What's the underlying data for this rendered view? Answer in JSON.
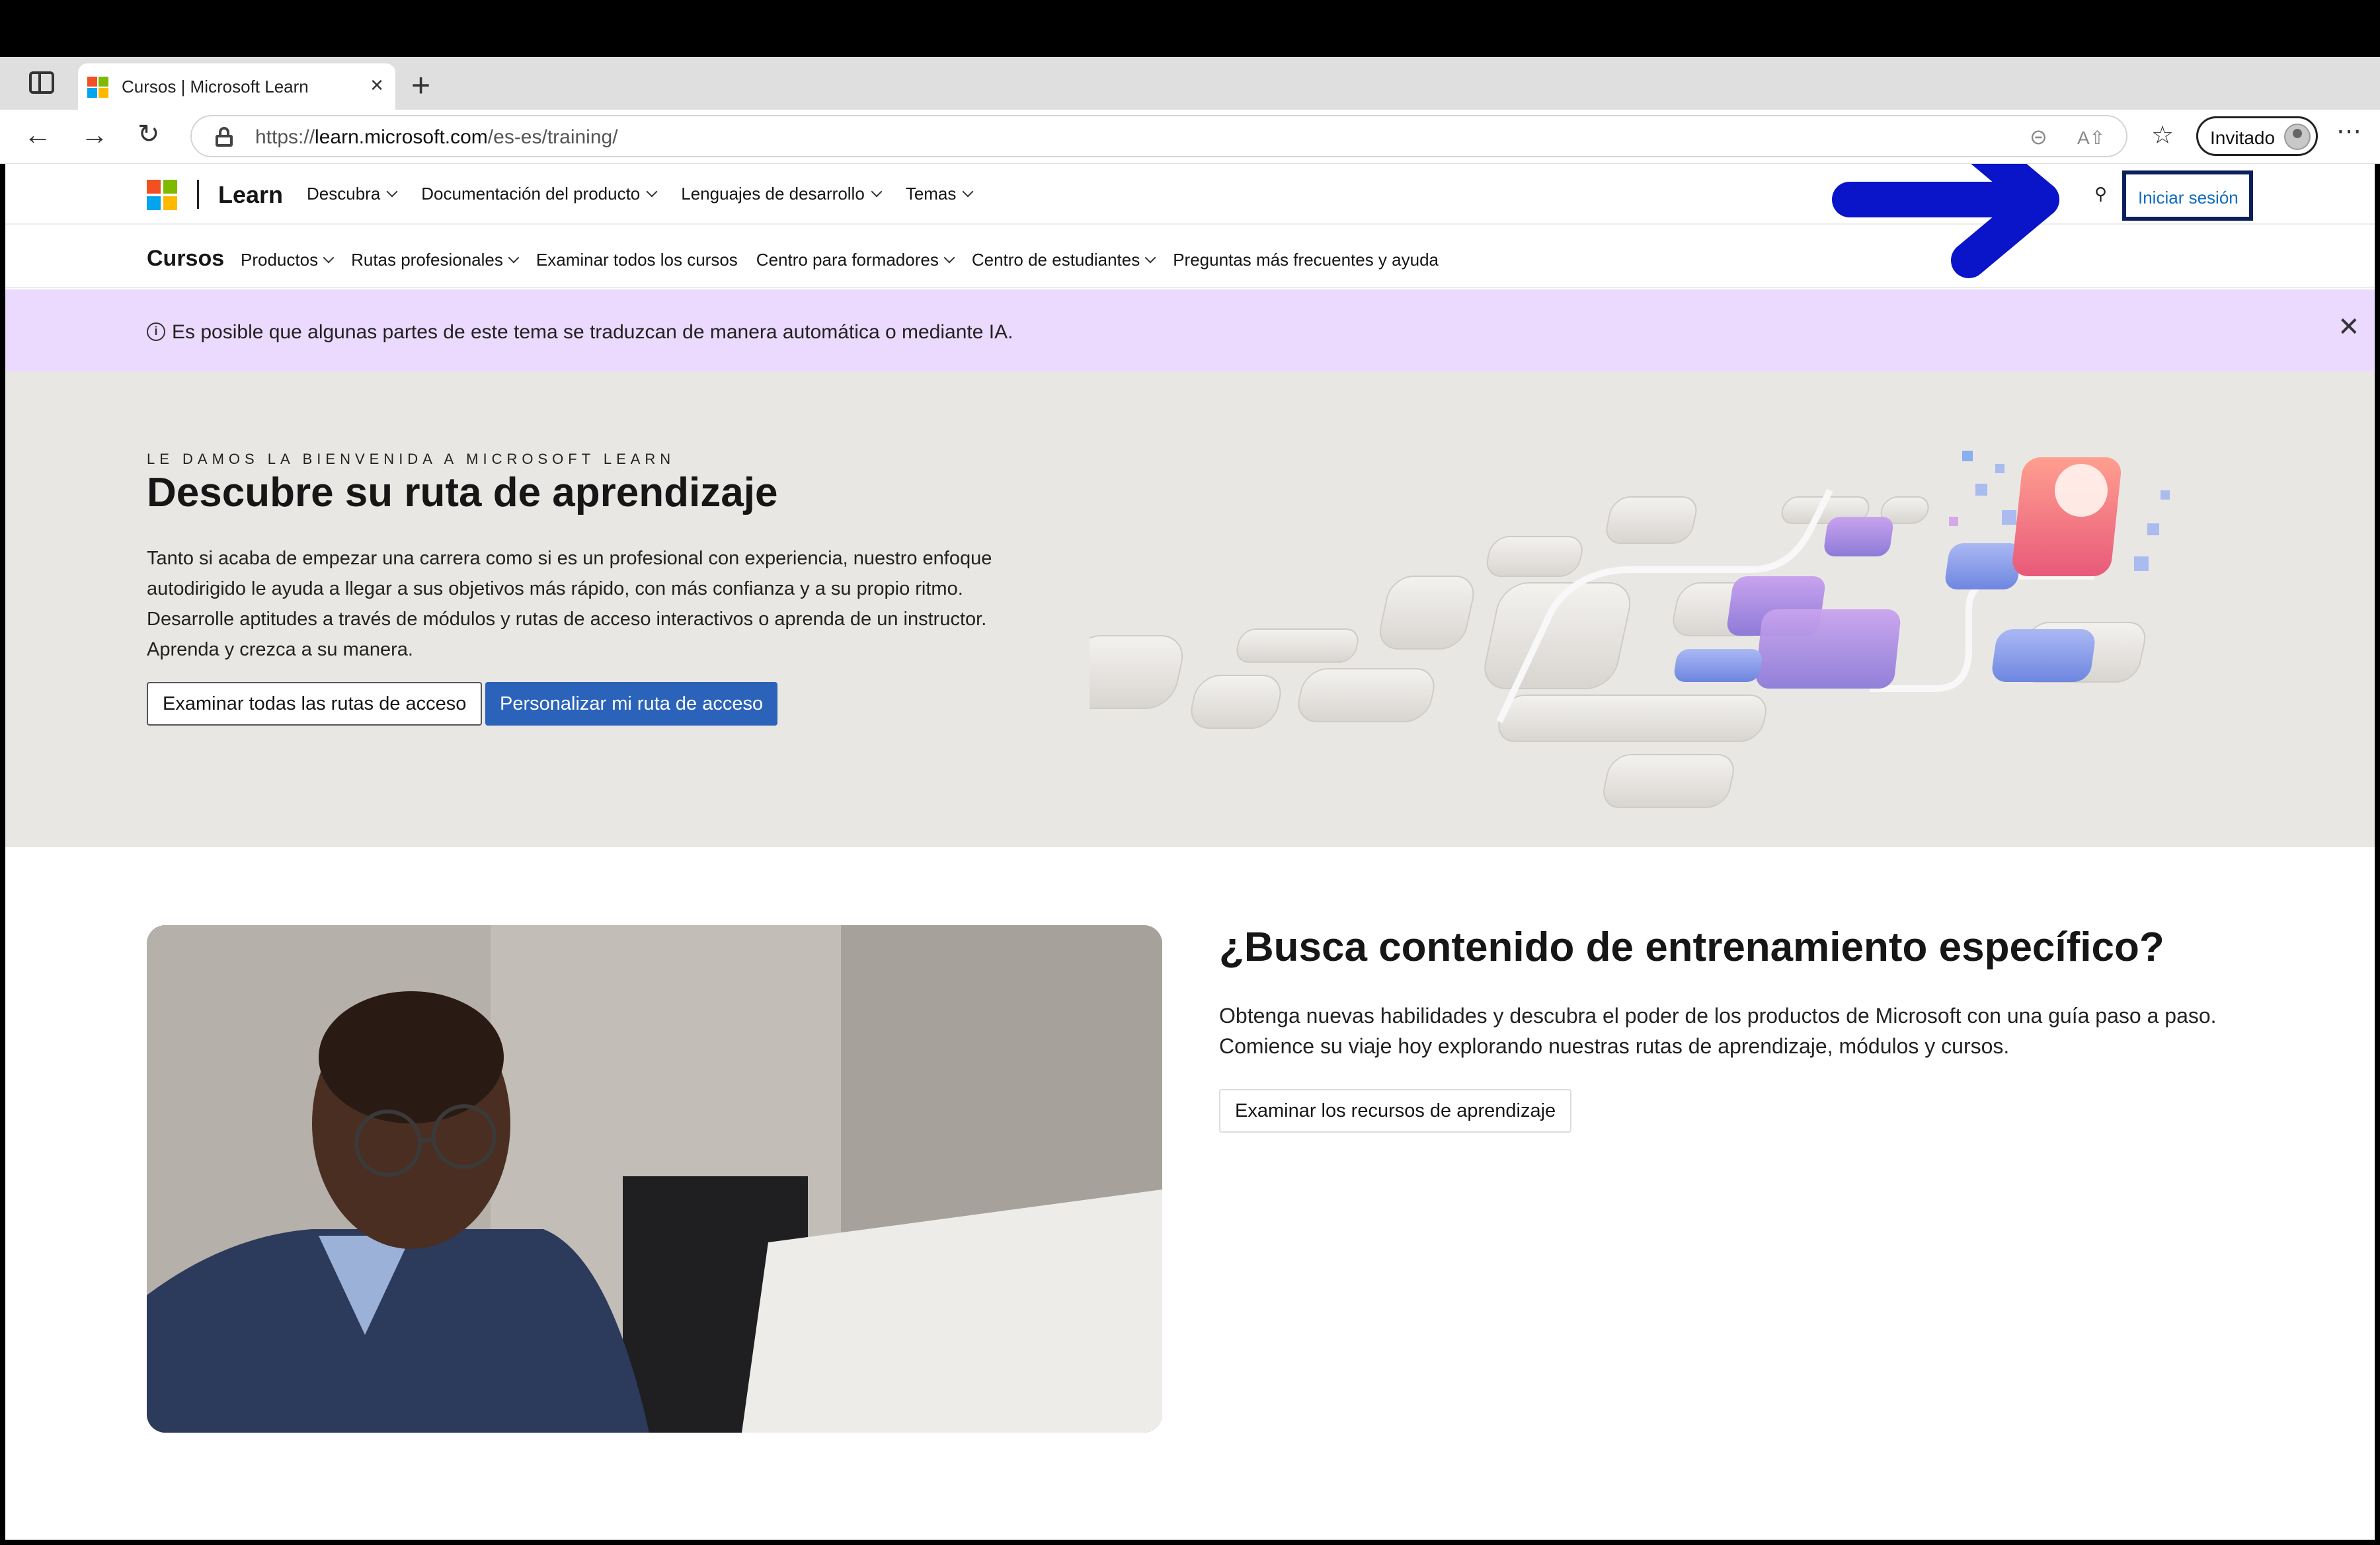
{
  "browser": {
    "tab_title": "Cursos | Microsoft Learn",
    "tab_close": "×",
    "new_tab": "+",
    "url_prefix": "https://",
    "url_domain": "learn.microsoft.com",
    "url_path": "/es-es/training/",
    "profile_label": "Invitado",
    "icons": [
      "sidebar-icon",
      "back-icon",
      "forward-icon",
      "reload-icon",
      "lock-icon",
      "zoom-icon",
      "read-aloud-icon",
      "favorites-icon",
      "more-icon"
    ]
  },
  "header": {
    "brand": "Learn",
    "nav": [
      {
        "label": "Descubra"
      },
      {
        "label": "Documentación del producto"
      },
      {
        "label": "Lenguajes de desarrollo"
      },
      {
        "label": "Temas"
      }
    ],
    "signin_label": "Iniciar sesión"
  },
  "subnav": {
    "title": "Cursos",
    "items": [
      {
        "label": "Productos",
        "dropdown": true
      },
      {
        "label": "Rutas profesionales",
        "dropdown": true
      },
      {
        "label": "Examinar todos los cursos",
        "dropdown": false
      },
      {
        "label": "Centro para formadores",
        "dropdown": true
      },
      {
        "label": "Centro de estudiantes",
        "dropdown": true
      },
      {
        "label": "Preguntas más frecuentes y ayuda",
        "dropdown": false
      }
    ]
  },
  "notice": {
    "text": "Es posible que algunas partes de este tema se traduzcan de manera automática o mediante IA.",
    "color": "#ebdafd"
  },
  "hero": {
    "eyebrow": "LE DAMOS LA BIENVENIDA A MICROSOFT LEARN",
    "title": "Descubre su ruta de aprendizaje",
    "description": "Tanto si acaba de empezar una carrera como si es un profesional con experiencia, nuestro enfoque autodirigido le ayuda a llegar a sus objetivos más rápido, con más confianza y a su propio ritmo. Desarrolle aptitudes a través de módulos y rutas de acceso interactivos o aprenda de un instructor. Aprenda y crezca a su manera.",
    "secondary_button": "Examinar todas las rutas de acceso",
    "primary_button": "Personalizar mi ruta de acceso",
    "primary_color": "#2b63ba"
  },
  "feature": {
    "title": "¿Busca contenido de entrenamiento específico?",
    "description": "Obtenga nuevas habilidades y descubra el poder de los productos de Microsoft con una guía paso a paso. Comience su viaje hoy explorando nuestras rutas de aprendizaje, módulos y cursos.",
    "button": "Examinar los recursos de aprendizaje"
  },
  "annotation": {
    "arrow_color": "#0a14c8",
    "highlight_color": "#0a1f5c"
  }
}
